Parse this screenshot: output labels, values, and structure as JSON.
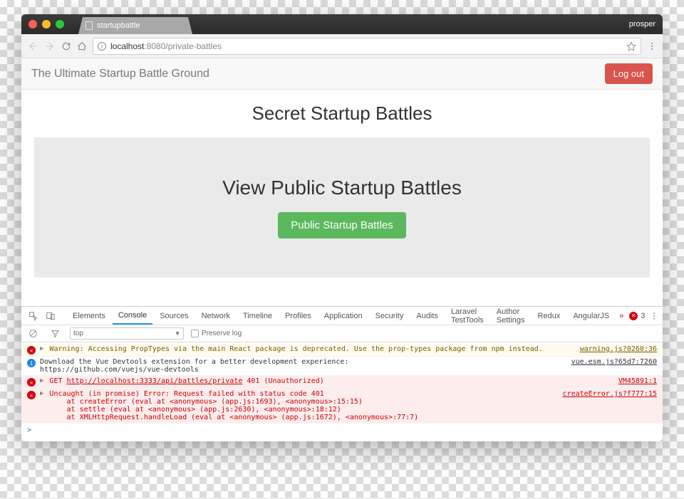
{
  "chrome": {
    "tab_title": "startupbattle",
    "user": "prosper",
    "url_host": "localhost",
    "url_port": ":8080",
    "url_path": "/private-battles"
  },
  "navbar": {
    "brand": "The Ultimate Startup Battle Ground",
    "logout": "Log out"
  },
  "page": {
    "title": "Secret Startup Battles",
    "card_title": "View Public Startup Battles",
    "button_label": "Public Startup Battles"
  },
  "devtools": {
    "tabs": [
      "Elements",
      "Console",
      "Sources",
      "Network",
      "Timeline",
      "Profiles",
      "Application",
      "Security",
      "Audits",
      "Laravel TestTools",
      "Author Settings",
      "Redux",
      "AngularJS"
    ],
    "active_tab": "Console",
    "error_count": "3",
    "subbar": {
      "context": "top",
      "preserve_label": "Preserve log"
    },
    "logs": [
      {
        "type": "warn",
        "caret": true,
        "text": "Warning: Accessing PropTypes via the main React package is deprecated. Use the prop-types package from npm instead.",
        "src": "warning.js?0260:36"
      },
      {
        "type": "info",
        "text": "Download the Vue Devtools extension for a better development experience:\nhttps://github.com/vuejs/vue-devtools",
        "src": "vue.esm.js?65d7:7260"
      },
      {
        "type": "error",
        "caret": true,
        "text": "GET http://localhost:3333/api/battles/private 401 (Unauthorized)",
        "src": "VM45891:1"
      },
      {
        "type": "error",
        "caret": true,
        "text": "Uncaught (in promise) Error: Request failed with status code 401\n    at createError (eval at <anonymous> (app.js:1693), <anonymous>:15:15)\n    at settle (eval at <anonymous> (app.js:2630), <anonymous>:18:12)\n    at XMLHttpRequest.handleLoad (eval at <anonymous> (app.js:1672), <anonymous>:77:7)",
        "src": "createError.js?f777:15"
      }
    ]
  }
}
